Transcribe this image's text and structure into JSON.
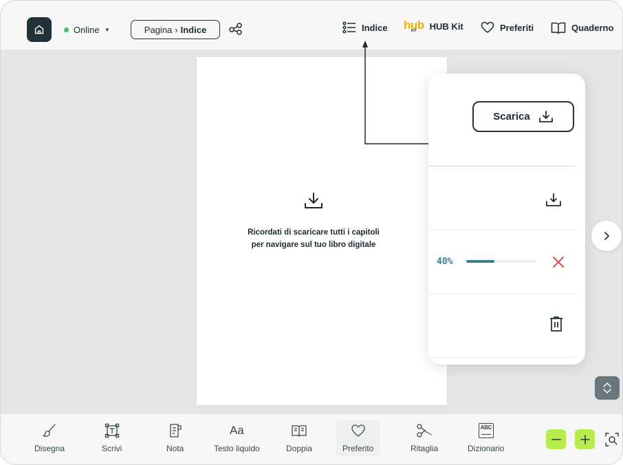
{
  "topbar": {
    "status": "Online",
    "breadcrumb": {
      "prefix": "Pagina",
      "separator": "›",
      "current": "Indice"
    },
    "nav": {
      "indice": "Indice",
      "hub_logo": "hub",
      "hub_logo_sub": "KIT",
      "hub_kit": "HUB Kit",
      "preferiti": "Preferiti",
      "quaderno": "Quaderno"
    }
  },
  "page": {
    "message_line1": "Ricordati di scaricare tutti i capitoli",
    "message_line2": "per navigare sul tuo libro digitale"
  },
  "panel": {
    "download_button": "Scarica",
    "progress_label": "40%",
    "progress_value": 0.4,
    "colors": {
      "progress": "#3d7d90",
      "cancel": "#e5484d"
    }
  },
  "toolbar": {
    "tools": [
      "Disegna",
      "Scrivi",
      "Nota",
      "Testo liquido",
      "Doppia",
      "Preferito",
      "Ritaglia",
      "Dizionario"
    ],
    "dizionario_icon_text": "ABC",
    "zoom_accent": "#b8ec4e"
  }
}
